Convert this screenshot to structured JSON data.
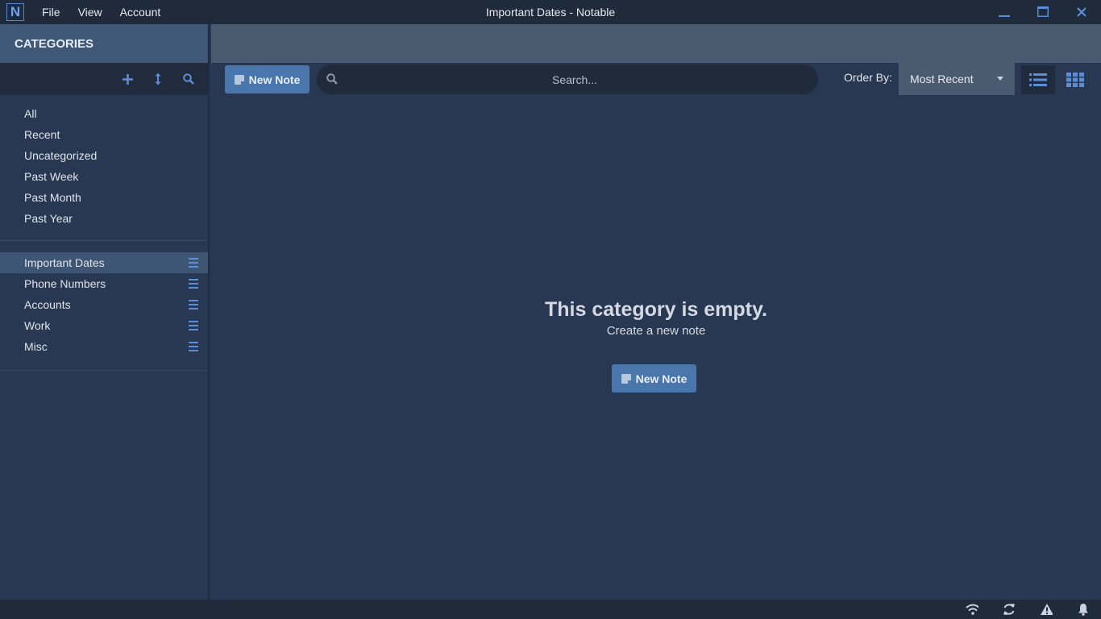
{
  "titlebar": {
    "logo_letter": "N",
    "menu": [
      "File",
      "View",
      "Account"
    ],
    "title": "Important Dates - Notable"
  },
  "sidebar": {
    "header": "CATEGORIES",
    "filters": [
      "All",
      "Recent",
      "Uncategorized",
      "Past Week",
      "Past Month",
      "Past Year"
    ],
    "categories": [
      "Important Dates",
      "Phone Numbers",
      "Accounts",
      "Work",
      "Misc"
    ],
    "active_category": "Important Dates"
  },
  "toolbar": {
    "new_note_label": "New Note",
    "search_placeholder": "Search...",
    "order_label": "Order By:",
    "order_value": "Most Recent"
  },
  "empty_state": {
    "title": "This category is empty.",
    "subtitle": "Create a new note",
    "button_label": "New Note"
  },
  "colors": {
    "accent": "#4a76ae",
    "icon_blue": "#5b8ed6",
    "background": "#283852"
  }
}
